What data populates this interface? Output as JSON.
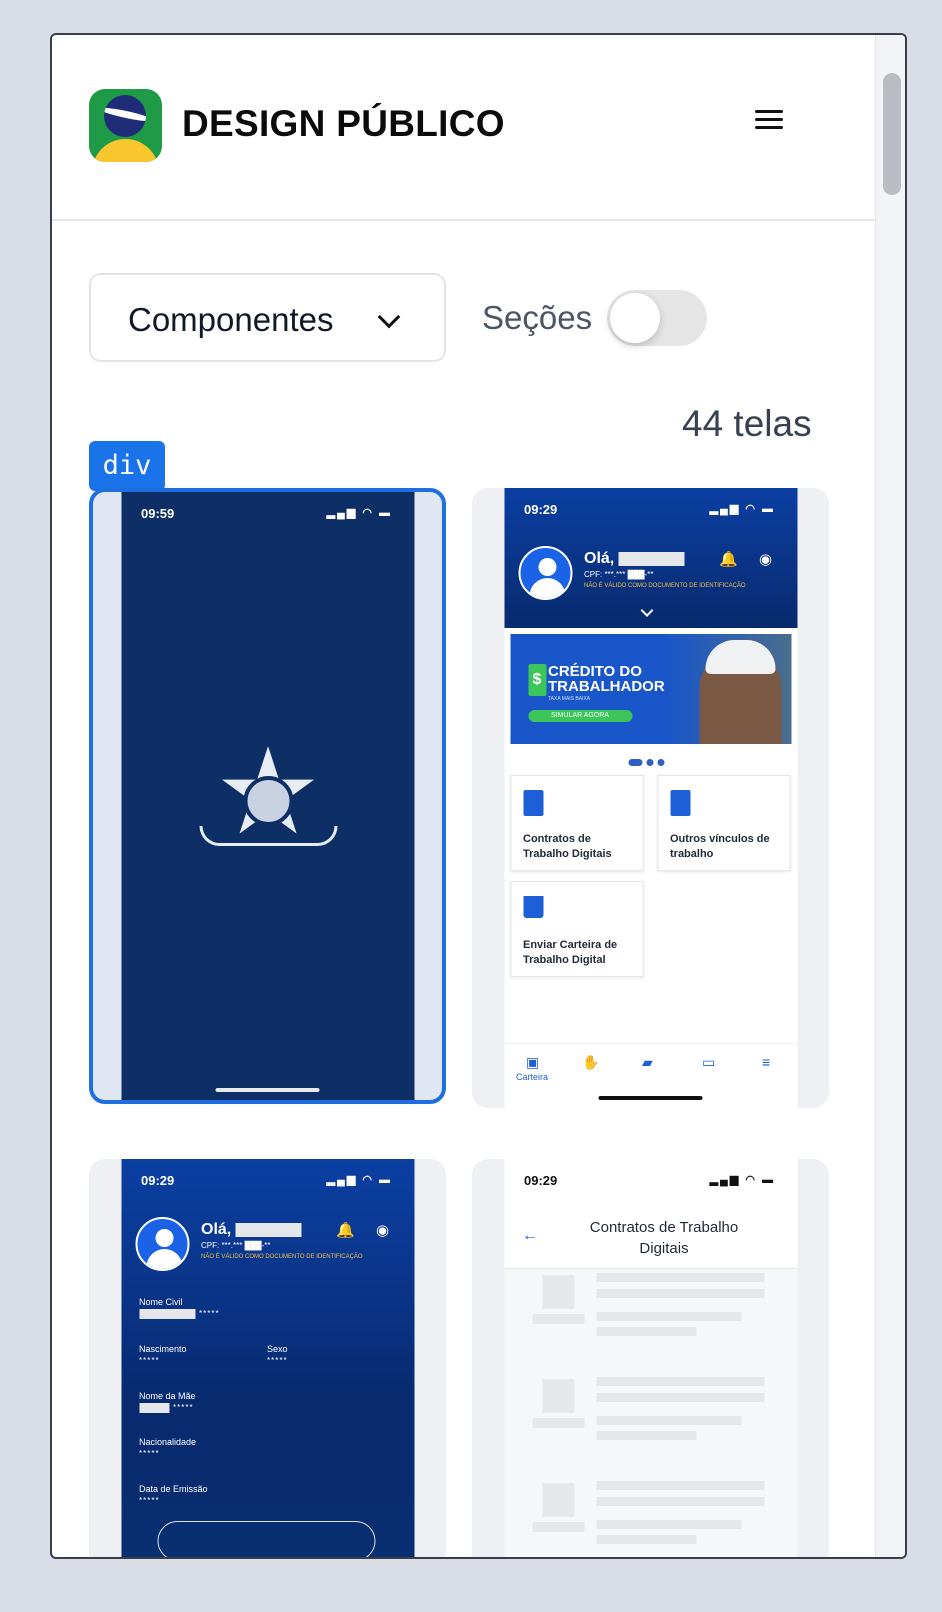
{
  "brand": {
    "bold": "DESIGN",
    "regular": "PÚBLICO"
  },
  "filters": {
    "dropdown_label": "Componentes",
    "toggle_label": "Seções",
    "toggle_on": false
  },
  "count_label": "44 telas",
  "tag_label": "div",
  "colors": {
    "accent": "#1a73e8",
    "splash_bg": "#0d2f66",
    "gov_blue": "#0b3fa3",
    "green": "#3cc65a",
    "yellow": "#f9c62d"
  },
  "screens": [
    {
      "time": "09:59",
      "status_icons": "▂▄▆ ◠ ▬",
      "emblem": "brazil-coat-of-arms-icon",
      "selected": true
    },
    {
      "time": "09:29",
      "status_icons": "▂▄▆ ◠ ▬",
      "greeting": "Olá,",
      "cpf": "CPF: ***.*** ███-**",
      "warning": "NÃO É VÁLIDO COMO DOCUMENTO DE IDENTIFICAÇÃO",
      "banner": {
        "title": "CRÉDITO DO TRABALHADOR",
        "subtitle": "TAXA MAIS BAIXA",
        "cta": "SIMULAR AGORA"
      },
      "tiles": [
        {
          "label": "Contratos de Trabalho Digitais",
          "icon": "clipboard-list-icon"
        },
        {
          "label": "Outros vínculos de trabalho",
          "icon": "document-icon"
        },
        {
          "label": "Enviar Carteira de Trabalho Digital",
          "icon": "upload-icon"
        }
      ],
      "tabbar": {
        "active_label": "Carteira",
        "icons": [
          "wallet-icon",
          "money-hand-icon",
          "briefcase-icon",
          "cash-icon",
          "menu-icon"
        ]
      }
    },
    {
      "time": "09:29",
      "status_icons": "▂▄▆ ◠ ▬",
      "greeting": "Olá,",
      "cpf": "CPF: ***.*** ███-**",
      "warning": "NÃO É VÁLIDO COMO DOCUMENTO DE IDENTIFICAÇÃO",
      "fields": {
        "nome_civil": "Nome Civil",
        "nascimento": "Nascimento",
        "sexo": "Sexo",
        "nome_mae": "Nome da Mãe",
        "nacionalidade": "Nacionalidade",
        "data_emissao": "Data de Emissão",
        "mask": "*****"
      }
    },
    {
      "time": "09:29",
      "status_icons": "▂▄▆ ◠ ▬",
      "title": "Contratos de Trabalho Digitais"
    }
  ]
}
